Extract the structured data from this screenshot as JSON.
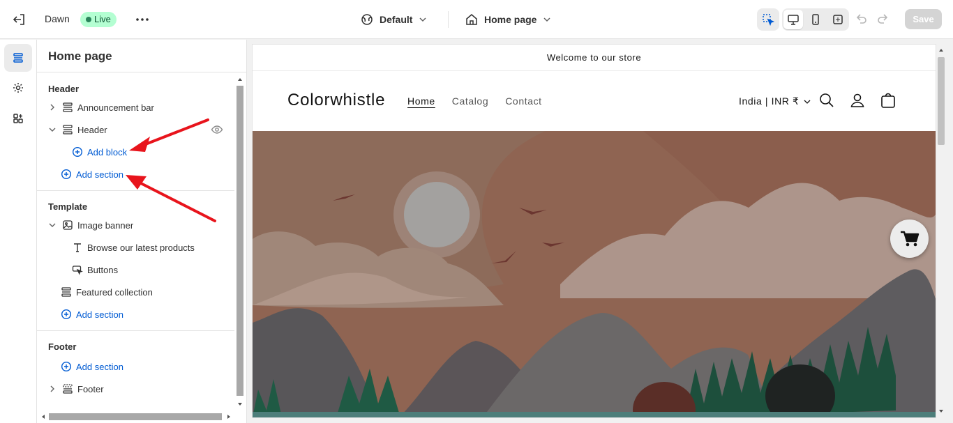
{
  "topbar": {
    "theme_name": "Dawn",
    "status_badge": "Live",
    "template_selector": "Default",
    "page_selector": "Home page",
    "save_label": "Save"
  },
  "sidebar": {
    "title": "Home page",
    "groups": {
      "header": {
        "heading": "Header",
        "items": [
          "Announcement bar",
          "Header"
        ],
        "add_block": "Add block",
        "add_section": "Add section"
      },
      "template": {
        "heading": "Template",
        "items": [
          "Image banner",
          "Browse our latest products",
          "Buttons",
          "Featured collection"
        ],
        "add_section": "Add section"
      },
      "footer": {
        "heading": "Footer",
        "add_section": "Add section",
        "items": [
          "Footer"
        ]
      }
    }
  },
  "preview": {
    "announcement": "Welcome to our store",
    "brand": "Colorwhistle",
    "nav": [
      "Home",
      "Catalog",
      "Contact"
    ],
    "currency": "India | INR ₹"
  },
  "colors": {
    "accent_blue": "#005bd3",
    "live_badge_bg": "#b4fed2",
    "annotation_arrow": "#e8141c"
  },
  "icons": [
    "exit-icon",
    "more-icon",
    "globe-icon",
    "home-icon",
    "inspector-icon",
    "desktop-icon",
    "mobile-icon",
    "fullscreen-icon",
    "undo-icon",
    "redo-icon",
    "sections-icon",
    "settings-icon",
    "apps-icon",
    "eye-icon",
    "search-icon",
    "account-icon",
    "cart-icon"
  ]
}
